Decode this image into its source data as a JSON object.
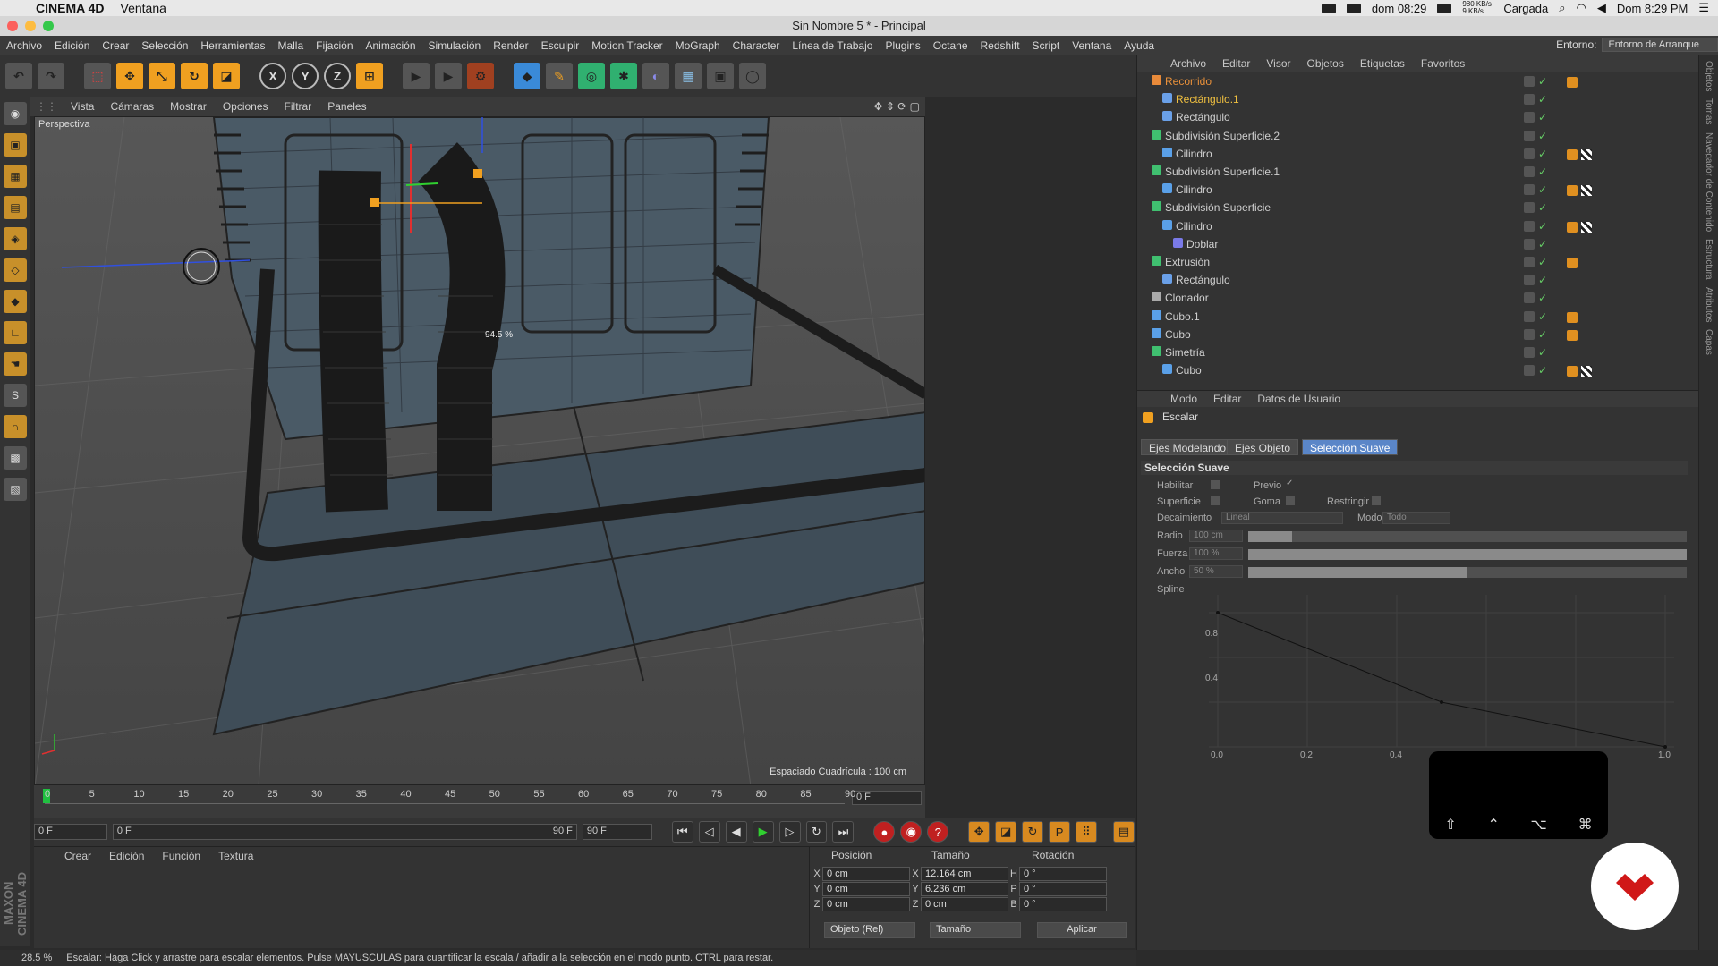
{
  "macbar": {
    "app": "CINEMA 4D",
    "menu": [
      "Ventana"
    ],
    "time_small": "dom 08:29",
    "net": "980 KB/s 9 KB/s",
    "battery": "Cargada",
    "clock": "Dom 8:29 PM"
  },
  "window_title": "Sin Nombre 5 * - Principal",
  "menubar": {
    "items": [
      "Archivo",
      "Edición",
      "Crear",
      "Selección",
      "Herramientas",
      "Malla",
      "Fijación",
      "Animación",
      "Simulación",
      "Render",
      "Esculpir",
      "Motion Tracker",
      "MoGraph",
      "Character",
      "Línea de Trabajo",
      "Plugins",
      "Octane",
      "Redshift",
      "Script",
      "Ventana",
      "Ayuda"
    ],
    "env_label": "Entorno:",
    "env_value": "Entorno de Arranque"
  },
  "viewport": {
    "menu": [
      "Vista",
      "Cámaras",
      "Mostrar",
      "Opciones",
      "Filtrar",
      "Paneles"
    ],
    "name": "Perspectiva",
    "grid_info": "Espaciado Cuadrícula : 100 cm",
    "handle_label": "94.5 %"
  },
  "timeline": {
    "ticks": [
      "0",
      "5",
      "10",
      "15",
      "20",
      "25",
      "30",
      "35",
      "40",
      "45",
      "50",
      "55",
      "60",
      "65",
      "70",
      "75",
      "80",
      "85",
      "90"
    ],
    "current_frame": "0 F"
  },
  "playbar": {
    "start": "0 F",
    "range_start": "0 F",
    "range_end": "90 F",
    "end": "90 F"
  },
  "material": {
    "menu": [
      "Crear",
      "Edición",
      "Función",
      "Textura"
    ]
  },
  "coords": {
    "headers": [
      "Posición",
      "Tamaño",
      "Rotación"
    ],
    "rows": [
      {
        "axis": "X",
        "pos": "0 cm",
        "size_axis": "X",
        "size": "12.164 cm",
        "rot_axis": "H",
        "rot": "0 °"
      },
      {
        "axis": "Y",
        "pos": "0 cm",
        "size_axis": "Y",
        "size": "6.236 cm",
        "rot_axis": "P",
        "rot": "0 °"
      },
      {
        "axis": "Z",
        "pos": "0 cm",
        "size_axis": "Z",
        "size": "0 cm",
        "rot_axis": "B",
        "rot": "0 °"
      }
    ],
    "mode": "Objeto (Rel)",
    "size_mode": "Tamaño",
    "apply": "Aplicar"
  },
  "status": {
    "zoom": "28.5 %",
    "message": "Escalar: Haga Click y arrastre para escalar elementos. Pulse MAYUSCULAS para cuantificar la escala / añadir a la selección en el modo punto. CTRL para restar."
  },
  "objects": {
    "menu": [
      "Archivo",
      "Editar",
      "Visor",
      "Objetos",
      "Etiquetas",
      "Favoritos"
    ],
    "items": [
      {
        "name": "Recorrido",
        "level": 0,
        "color": "#e88a3a",
        "text": "#e8903a",
        "tag": true,
        "tag2": false
      },
      {
        "name": "Rectángulo.1",
        "level": 1,
        "color": "#6aa0e8",
        "text": "#f0c040",
        "tag": false,
        "tag2": false
      },
      {
        "name": "Rectángulo",
        "level": 1,
        "color": "#6aa0e8",
        "text": "#cfcfcf",
        "tag": false,
        "tag2": false
      },
      {
        "name": "Subdivisión Superficie.2",
        "level": 0,
        "color": "#40c070",
        "text": "#cfcfcf",
        "tag": false,
        "tag2": false
      },
      {
        "name": "Cilindro",
        "level": 1,
        "color": "#5aa0e8",
        "text": "#cfcfcf",
        "tag": true,
        "tag2": true
      },
      {
        "name": "Subdivisión Superficie.1",
        "level": 0,
        "color": "#40c070",
        "text": "#cfcfcf",
        "tag": false,
        "tag2": false
      },
      {
        "name": "Cilindro",
        "level": 1,
        "color": "#5aa0e8",
        "text": "#cfcfcf",
        "tag": true,
        "tag2": true
      },
      {
        "name": "Subdivisión Superficie",
        "level": 0,
        "color": "#40c070",
        "text": "#cfcfcf",
        "tag": false,
        "tag2": false
      },
      {
        "name": "Cilindro",
        "level": 1,
        "color": "#5aa0e8",
        "text": "#cfcfcf",
        "tag": true,
        "tag2": true
      },
      {
        "name": "Doblar",
        "level": 2,
        "color": "#7a7ae8",
        "text": "#cfcfcf",
        "tag": false,
        "tag2": false
      },
      {
        "name": "Extrusión",
        "level": 0,
        "color": "#40c070",
        "text": "#cfcfcf",
        "tag": true,
        "tag2": false
      },
      {
        "name": "Rectángulo",
        "level": 1,
        "color": "#6aa0e8",
        "text": "#cfcfcf",
        "tag": false,
        "tag2": false
      },
      {
        "name": "Clonador",
        "level": 0,
        "color": "#aaaaaa",
        "text": "#cfcfcf",
        "tag": false,
        "tag2": false
      },
      {
        "name": "Cubo.1",
        "level": 0,
        "color": "#5aa0e8",
        "text": "#cfcfcf",
        "tag": true,
        "tag2": false
      },
      {
        "name": "Cubo",
        "level": 0,
        "color": "#5aa0e8",
        "text": "#cfcfcf",
        "tag": true,
        "tag2": false
      },
      {
        "name": "Simetría",
        "level": 0,
        "color": "#40c070",
        "text": "#cfcfcf",
        "tag": false,
        "tag2": false
      },
      {
        "name": "Cubo",
        "level": 1,
        "color": "#5aa0e8",
        "text": "#cfcfcf",
        "tag": true,
        "tag2": true
      }
    ]
  },
  "attributes": {
    "menu": [
      "Modo",
      "Editar",
      "Datos de Usuario"
    ],
    "tool": "Escalar",
    "tabs": [
      {
        "label": "Ejes Modelando",
        "selected": false
      },
      {
        "label": "Ejes Objeto",
        "selected": false
      },
      {
        "label": "Selección Suave",
        "selected": true
      }
    ],
    "section": "Selección Suave",
    "habilitar": "Habilitar",
    "previo": "Previo",
    "superficie": "Superficie",
    "goma": "Goma",
    "restringir": "Restringir",
    "decaimiento_label": "Decaimiento",
    "decaimiento_value": "Lineal",
    "modo_label": "Modo",
    "modo_value": "Todo",
    "radio_label": "Radio",
    "radio_value": "100 cm",
    "radio_fill": 0.1,
    "fuerza_label": "Fuerza",
    "fuerza_value": "100 %",
    "fuerza_fill": 1.0,
    "ancho_label": "Ancho",
    "ancho_value": "50 %",
    "ancho_fill": 0.5,
    "spline_label": "Spline",
    "spline_y_ticks": [
      "0.8",
      "0.4"
    ],
    "spline_x_ticks": [
      "0.0",
      "0.2",
      "0.4",
      "0.6",
      "0.8",
      "1.0"
    ]
  },
  "side_tabs": [
    "Objetos",
    "Tomas",
    "Navegador de Contenido",
    "Estructura",
    "Atributos",
    "Capas"
  ],
  "keyboard_keys": [
    "⇧",
    "⌃",
    "⌥",
    "⌘"
  ]
}
